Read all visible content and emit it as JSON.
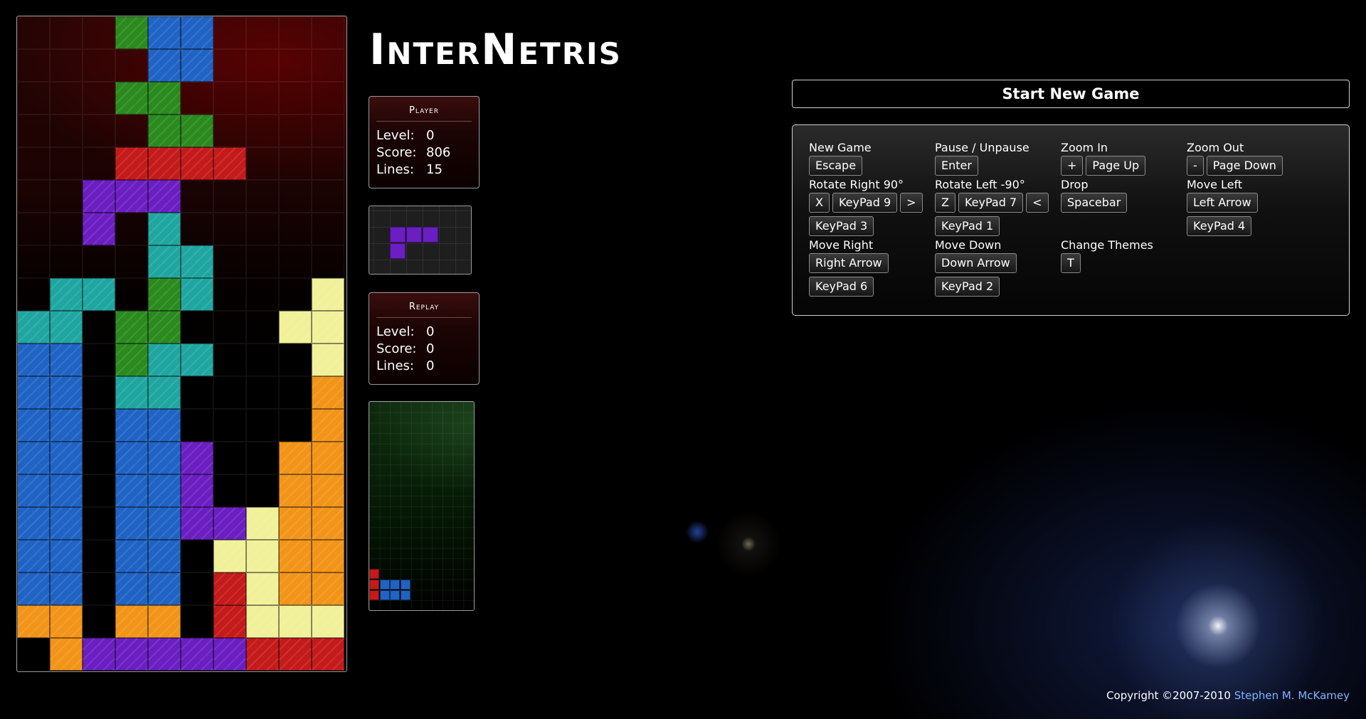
{
  "title": "InterNetris",
  "colors": {
    "red": "#c41a1a",
    "blue": "#1f63c4",
    "green": "#2a8a1e",
    "cyan": "#1fa6a0",
    "purple": "#6b1ec2",
    "yellow": "#f1f19a",
    "orange": "#f29418"
  },
  "board": {
    "rows": [
      "...GBB....",
      "....BB....",
      "...GG.....",
      "....GG....",
      "...RRRR...",
      "..PPP.....",
      "..P.C.....",
      "....CC....",
      ".CC.GC...Y",
      "CC.GG...YY",
      "BB.GCC...Y",
      "BB.CC....O",
      "BB.BB....O",
      "BB.BBP..OO",
      "BB.BBP..OO",
      "BB.BBPPYOO",
      "BB.BB.YYOO",
      "BB.BB.RYOO",
      "OO.OO.RYYY",
      ".OPPPPPRRR"
    ]
  },
  "player_panel": {
    "title": "Player",
    "level_label": "Level:",
    "level": "0",
    "score_label": "Score:",
    "score": "806",
    "lines_label": "Lines:",
    "lines": "15"
  },
  "next_piece": {
    "color": "purple",
    "cells": [
      [
        1,
        1
      ],
      [
        2,
        1
      ],
      [
        3,
        1
      ],
      [
        1,
        2
      ]
    ]
  },
  "replay_panel": {
    "title": "Replay",
    "level_label": "Level:",
    "level": "0",
    "score_label": "Score:",
    "score": "0",
    "lines_label": "Lines:",
    "lines": "0"
  },
  "replay_board": {
    "blocks": [
      {
        "color": "red",
        "col": 0,
        "row": 16
      },
      {
        "color": "red",
        "col": 0,
        "row": 17
      },
      {
        "color": "red",
        "col": 0,
        "row": 18
      },
      {
        "color": "blue",
        "col": 1,
        "row": 17
      },
      {
        "color": "blue",
        "col": 2,
        "row": 17
      },
      {
        "color": "blue",
        "col": 3,
        "row": 17
      },
      {
        "color": "blue",
        "col": 1,
        "row": 18
      },
      {
        "color": "blue",
        "col": 2,
        "row": 18
      },
      {
        "color": "blue",
        "col": 3,
        "row": 18
      }
    ]
  },
  "start_button": "Start New Game",
  "controls": {
    "new_game": {
      "label": "New Game",
      "keys": [
        "Escape"
      ]
    },
    "pause": {
      "label": "Pause / Unpause",
      "keys": [
        "Enter"
      ]
    },
    "zoom_in": {
      "label": "Zoom In",
      "keys": [
        "+",
        "Page Up"
      ]
    },
    "zoom_out": {
      "label": "Zoom Out",
      "keys": [
        "-",
        "Page Down"
      ]
    },
    "rotate_right": {
      "label": "Rotate Right 90°",
      "keys": [
        "X",
        "KeyPad 9",
        ">"
      ],
      "keys2": [
        "KeyPad 3"
      ]
    },
    "rotate_left": {
      "label": "Rotate Left -90°",
      "keys": [
        "Z",
        "KeyPad 7",
        "<"
      ],
      "keys2": [
        "KeyPad 1"
      ]
    },
    "drop": {
      "label": "Drop",
      "keys": [
        "Spacebar"
      ]
    },
    "move_left": {
      "label": "Move Left",
      "keys": [
        "Left Arrow"
      ],
      "keys2": [
        "KeyPad 4"
      ]
    },
    "move_right": {
      "label": "Move Right",
      "keys": [
        "Right Arrow"
      ],
      "keys2": [
        "KeyPad 6"
      ]
    },
    "move_down": {
      "label": "Move Down",
      "keys": [
        "Down Arrow"
      ],
      "keys2": [
        "KeyPad 2"
      ]
    },
    "themes": {
      "label": "Change Themes",
      "keys": [
        "T"
      ]
    }
  },
  "footer": {
    "copyright": "Copyright ©2007-2010",
    "author": "Stephen M. McKamey"
  }
}
